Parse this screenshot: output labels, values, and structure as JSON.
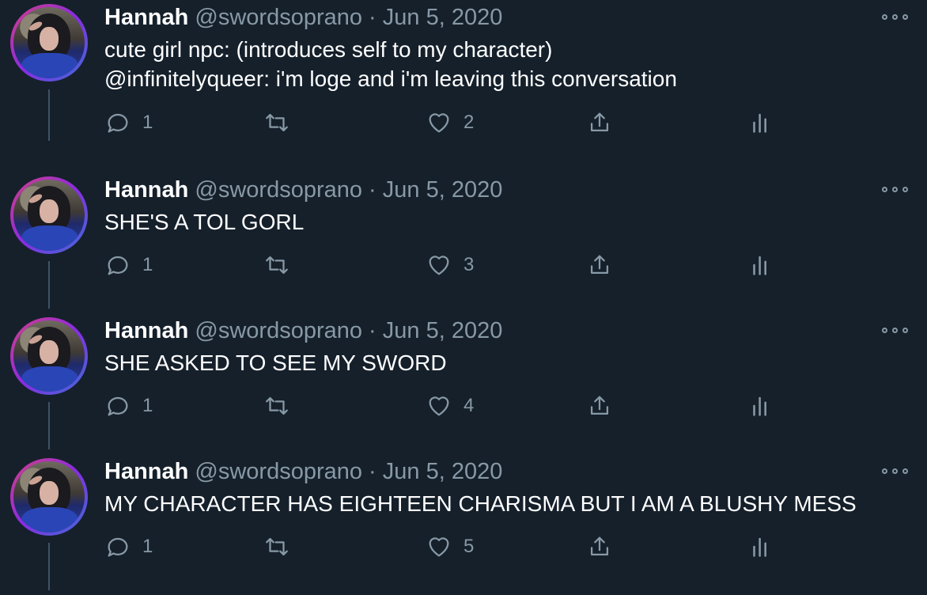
{
  "tweets": [
    {
      "name": "Hannah",
      "meta": "@swordsoprano · Jun 5, 2020",
      "lines": [
        "cute girl npc: (introduces self to my character)",
        "@infinitelyqueer: i'm loge and i'm leaving this conversation"
      ],
      "replies": "1",
      "likes": "2"
    },
    {
      "name": "Hannah",
      "meta": "@swordsoprano · Jun 5, 2020",
      "lines": [
        "SHE'S A TOL GORL"
      ],
      "replies": "1",
      "likes": "3"
    },
    {
      "name": "Hannah",
      "meta": "@swordsoprano · Jun 5, 2020",
      "lines": [
        "SHE ASKED TO SEE MY SWORD"
      ],
      "replies": "1",
      "likes": "4"
    },
    {
      "name": "Hannah",
      "meta": "@swordsoprano · Jun 5, 2020",
      "lines": [
        "MY CHARACTER HAS EIGHTEEN CHARISMA BUT I AM A BLUSHY MESS"
      ],
      "replies": "1",
      "likes": "5"
    }
  ],
  "colors": {
    "background": "#15202b",
    "text": "#ffffff",
    "muted": "#8899a6",
    "thread_line": "#3d5466"
  },
  "icons": {
    "reply": "reply-icon",
    "retweet": "retweet-icon",
    "like": "like-icon",
    "share": "share-icon",
    "analytics": "analytics-icon",
    "more": "more-icon"
  }
}
